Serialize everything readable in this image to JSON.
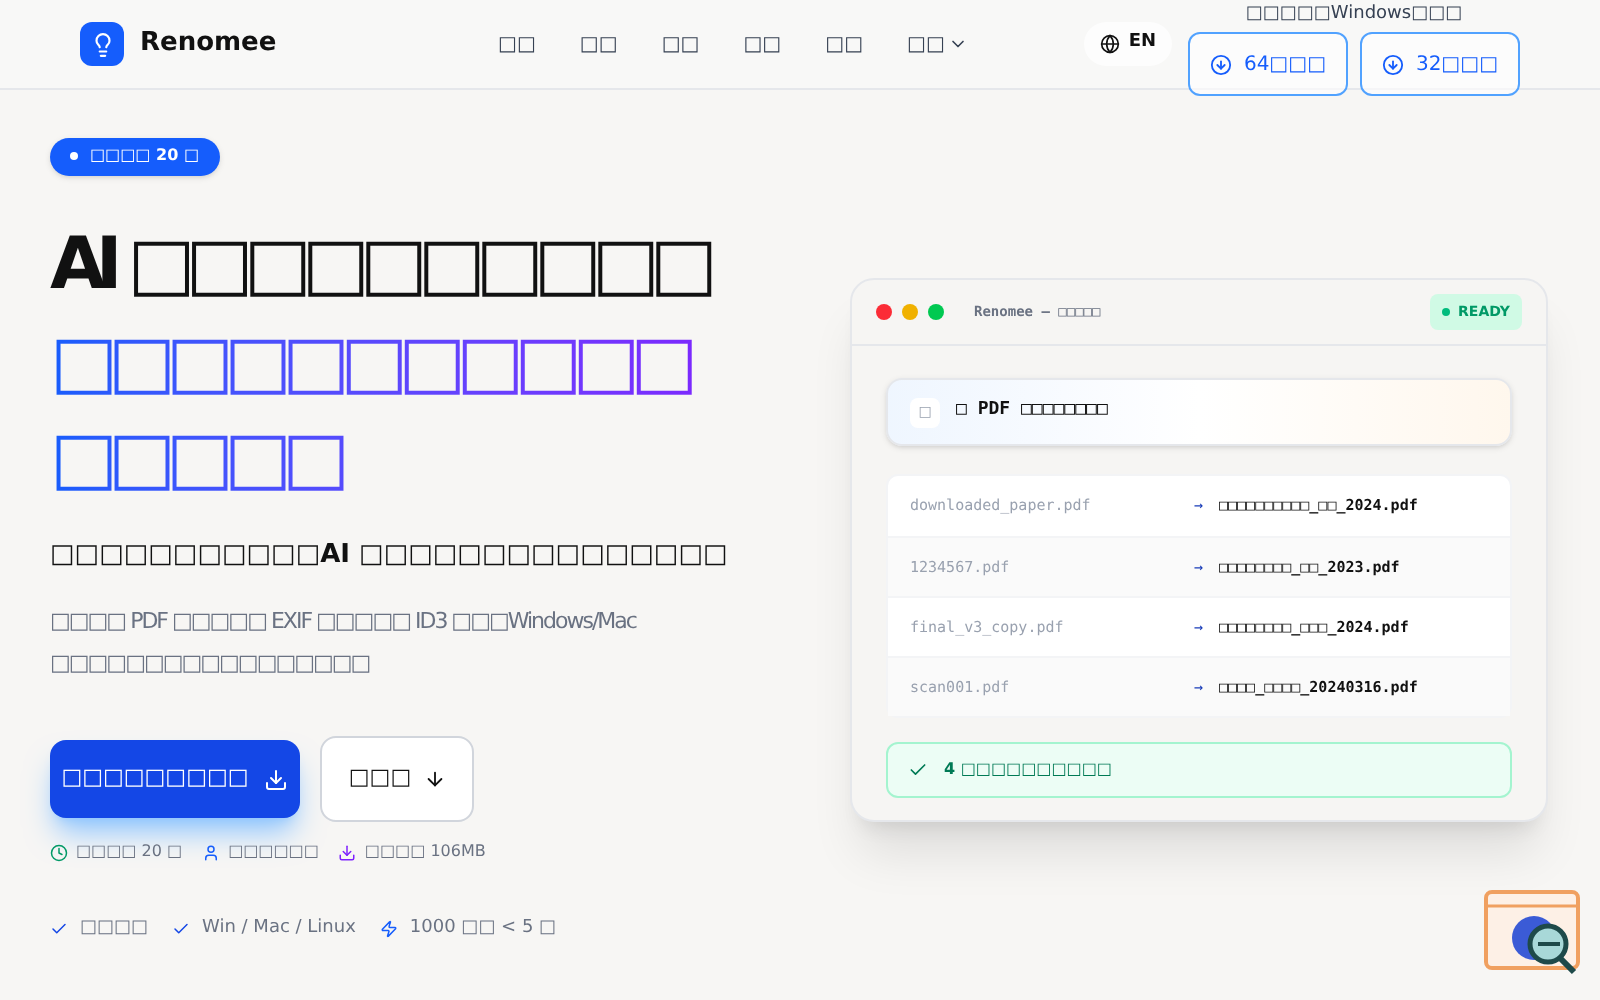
{
  "brand": {
    "name": "Renomee"
  },
  "nav": [
    {
      "label": "□□",
      "dropdown": false
    },
    {
      "label": "□□",
      "dropdown": false
    },
    {
      "label": "□□",
      "dropdown": false
    },
    {
      "label": "□□",
      "dropdown": false
    },
    {
      "label": "□□",
      "dropdown": false
    },
    {
      "label": "□□",
      "dropdown": true
    }
  ],
  "language": "EN",
  "download_note": "□□□□□Windows□□□",
  "download_buttons": [
    "64□□□",
    "32□□□"
  ],
  "badge": "□□□□ 20 □",
  "headline": "AI □□□□□□□□□□",
  "headline_accent": "□□□□□□□□□□□□□□□□",
  "subtitle": "□□□□□□□□□□□AI □□□□□□□□□□□□□□□",
  "description": "□□□□ PDF □□□□□ EXIF □□□□□ ID3 □□□Windows/Mac □□□□□□□□□□□□□□□□□",
  "primary_button": "□□□□□□□□□",
  "secondary_button": "□□□",
  "meta": [
    {
      "kind": "clock",
      "text": "□□□□ 20 □"
    },
    {
      "kind": "user",
      "text": "□□□□□□"
    },
    {
      "kind": "download",
      "text": "□□□□ 106MB"
    }
  ],
  "features": [
    {
      "kind": "check",
      "text": "□□□□"
    },
    {
      "kind": "check",
      "text": "Win / Mac / Linux"
    },
    {
      "kind": "bolt",
      "text": "1000 □□ < 5 □"
    }
  ],
  "app_window": {
    "title": "Renomee — □□□□□",
    "status": "READY",
    "drop_icon": "□",
    "drop_text": "□ PDF □□□□□□□□",
    "files": [
      {
        "from": "downloaded_paper.pdf",
        "arrow": "→",
        "to": "□□□□□□□□□□_□□_2024.pdf"
      },
      {
        "from": "1234567.pdf",
        "arrow": "→",
        "to": "□□□□□□□□_□□_2023.pdf"
      },
      {
        "from": "final_v3_copy.pdf",
        "arrow": "→",
        "to": "□□□□□□□□_□□□_2024.pdf"
      },
      {
        "from": "scan001.pdf",
        "arrow": "→",
        "to": "□□□□_□□□□_20240316.pdf"
      }
    ],
    "result": "4 □□□□□□□□□□"
  }
}
